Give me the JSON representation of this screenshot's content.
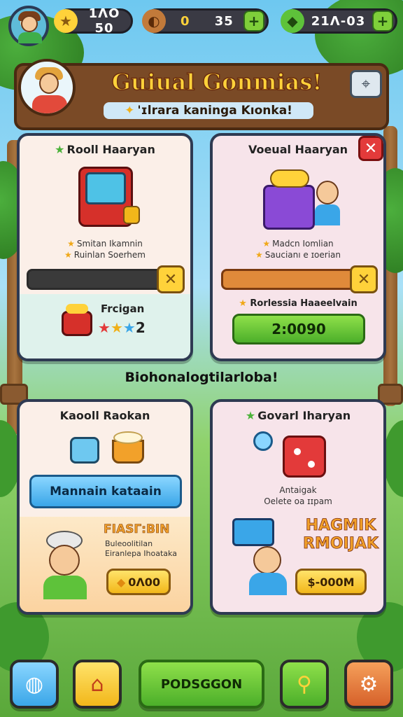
{
  "topbar": {
    "currency1": {
      "icon": "star-icon",
      "value": "1ΛΟ 50"
    },
    "currency2": {
      "icon": "coin-icon",
      "value_a": "0",
      "value_b": "35"
    },
    "currency3": {
      "icon": "gem-icon",
      "value": "21Λ-03"
    },
    "plus_label": "+"
  },
  "banner": {
    "title": "Guiual Gonmias!",
    "subtitle": "'ɪlrara kaninga Kıonka!"
  },
  "card1": {
    "title": "Rooll Haaryan",
    "bullets": [
      "Smitan Ikamnin",
      "Ruinlan Soerhem"
    ],
    "bar_x": "✕",
    "reward_title": "Frcigan",
    "stars_label": "2"
  },
  "card2": {
    "title": "Voeual Haaryan",
    "close": "✕",
    "bullets": [
      "Madcn Iomlian",
      "Saucianı e ɪoerian"
    ],
    "bar_x": "✕",
    "reward_title": "Rorlessia Haaeelvain",
    "button": "2:0090"
  },
  "mid_label": "Biohonalogtilarloba!",
  "card3": {
    "title": "Kaooll Raokan",
    "button": "Mannain kataain",
    "promo_title": "FIASГ:BIN",
    "promo_lines": [
      "Buleoolitilan",
      "Eiranlepa Ihoataka"
    ],
    "price": "0Λ00"
  },
  "card4": {
    "title": "Govarl Iharyan",
    "bullets": [
      "Antaigak",
      "Oelete oa ɪɪpam"
    ],
    "promo_title": "HAGMIK RMOIJAK",
    "price": "$-000M"
  },
  "nav": {
    "main": "PODSGGON"
  },
  "colors": {
    "accent_green": "#4caf2a",
    "accent_yellow": "#f2b71a",
    "banner_brown": "#7a4a26"
  }
}
